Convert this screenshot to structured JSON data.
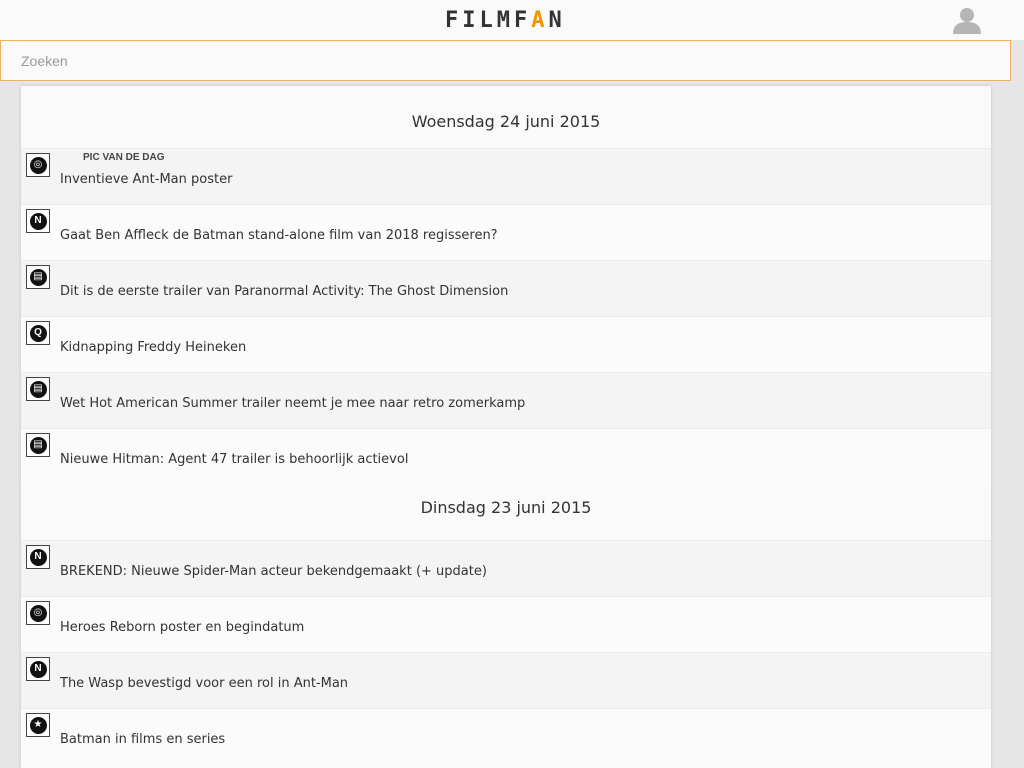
{
  "header": {
    "logo_prefix": "FILMF",
    "logo_accent": "A",
    "logo_suffix": "N",
    "user_icon": "user-icon"
  },
  "search": {
    "placeholder": "Zoeken"
  },
  "colors": {
    "accent": "#f29400",
    "search_border": "#f0b060"
  },
  "days": [
    {
      "title": "Woensdag 24 juni 2015",
      "items": [
        {
          "tag": "PIC VAN DE DAG",
          "label": "Inventieve Ant-Man poster",
          "icon": "picture-icon",
          "glyph": "◎"
        },
        {
          "tag": "",
          "label": "Gaat Ben Affleck de Batman stand-alone film van 2018 regisseren?",
          "icon": "news-icon",
          "glyph": "N"
        },
        {
          "tag": "",
          "label": "Dit is de eerste trailer van Paranormal Activity: The Ghost Dimension",
          "icon": "film-icon",
          "glyph": "▤"
        },
        {
          "tag": "",
          "label": "Kidnapping Freddy Heineken",
          "icon": "review-icon",
          "glyph": "Q"
        },
        {
          "tag": "",
          "label": "Wet Hot American Summer trailer neemt je mee naar retro zomerkamp",
          "icon": "film-icon",
          "glyph": "▤"
        },
        {
          "tag": "",
          "label": "Nieuwe Hitman: Agent 47 trailer is behoorlijk actievol",
          "icon": "film-icon",
          "glyph": "▤"
        }
      ]
    },
    {
      "title": "Dinsdag 23 juni 2015",
      "items": [
        {
          "tag": "",
          "label": "BREKEND: Nieuwe Spider-Man acteur bekendgemaakt (+ update)",
          "icon": "news-icon",
          "glyph": "N"
        },
        {
          "tag": "",
          "label": "Heroes Reborn poster en begindatum",
          "icon": "picture-icon",
          "glyph": "◎"
        },
        {
          "tag": "",
          "label": "The Wasp bevestigd voor een rol in Ant-Man",
          "icon": "news-icon",
          "glyph": "N"
        },
        {
          "tag": "",
          "label": "Batman in films en series",
          "icon": "star-icon",
          "glyph": "★"
        }
      ]
    }
  ]
}
